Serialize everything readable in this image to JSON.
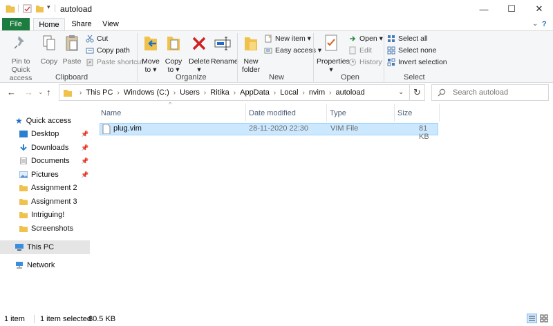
{
  "window": {
    "title": "autoload",
    "minimize_glyph": "—",
    "maximize_glyph": "☐",
    "close_glyph": "✕"
  },
  "tabs": [
    {
      "label": "File"
    },
    {
      "label": "Home"
    },
    {
      "label": "Share"
    },
    {
      "label": "View"
    }
  ],
  "ribbon": {
    "clipboard": {
      "group_label": "Clipboard",
      "pin_label_1": "Pin to Quick",
      "pin_label_2": "access",
      "copy_label": "Copy",
      "paste_label": "Paste",
      "cut_label": "Cut",
      "copy_path_label": "Copy path",
      "paste_shortcut_label": "Paste shortcut"
    },
    "organize": {
      "group_label": "Organize",
      "move_label_1": "Move",
      "move_label_2": "to ▾",
      "copy_label_1": "Copy",
      "copy_label_2": "to ▾",
      "delete_label": "Delete",
      "delete_arrow": "▾",
      "rename_label": "Rename"
    },
    "new": {
      "group_label": "New",
      "new_folder_label_1": "New",
      "new_folder_label_2": "folder",
      "new_item_label": "New item ▾",
      "easy_access_label": "Easy access ▾"
    },
    "open": {
      "group_label": "Open",
      "properties_label": "Properties",
      "properties_arrow": "▾",
      "open_label": "Open ▾",
      "edit_label": "Edit",
      "history_label": "History"
    },
    "select": {
      "group_label": "Select",
      "select_all_label": "Select all",
      "select_none_label": "Select none",
      "invert_label": "Invert selection"
    }
  },
  "address": {
    "crumbs": [
      "This PC",
      "Windows (C:)",
      "Users",
      "Ritika",
      "AppData",
      "Local",
      "nvim",
      "autoload"
    ],
    "search_placeholder": "Search autoload"
  },
  "sidebar": {
    "quick_access": "Quick access",
    "items": [
      {
        "label": "Desktop"
      },
      {
        "label": "Downloads"
      },
      {
        "label": "Documents"
      },
      {
        "label": "Pictures"
      },
      {
        "label": "Assignment 2"
      },
      {
        "label": "Assignment 3"
      },
      {
        "label": "Intriguing!"
      },
      {
        "label": "Screenshots"
      }
    ],
    "this_pc": "This PC",
    "network": "Network"
  },
  "filelist": {
    "columns": [
      "Name",
      "Date modified",
      "Type",
      "Size"
    ],
    "rows": [
      {
        "name": "plug.vim",
        "date": "28-11-2020 22:30",
        "type": "VIM File",
        "size": "81 KB"
      }
    ]
  },
  "status": {
    "item_count": "1 item",
    "selected": "1 item selected",
    "size": "80.5 KB"
  },
  "colors": {
    "file_tab": "#1d7c3f",
    "selection": "#cce8ff",
    "folder": "#f0c24b"
  }
}
